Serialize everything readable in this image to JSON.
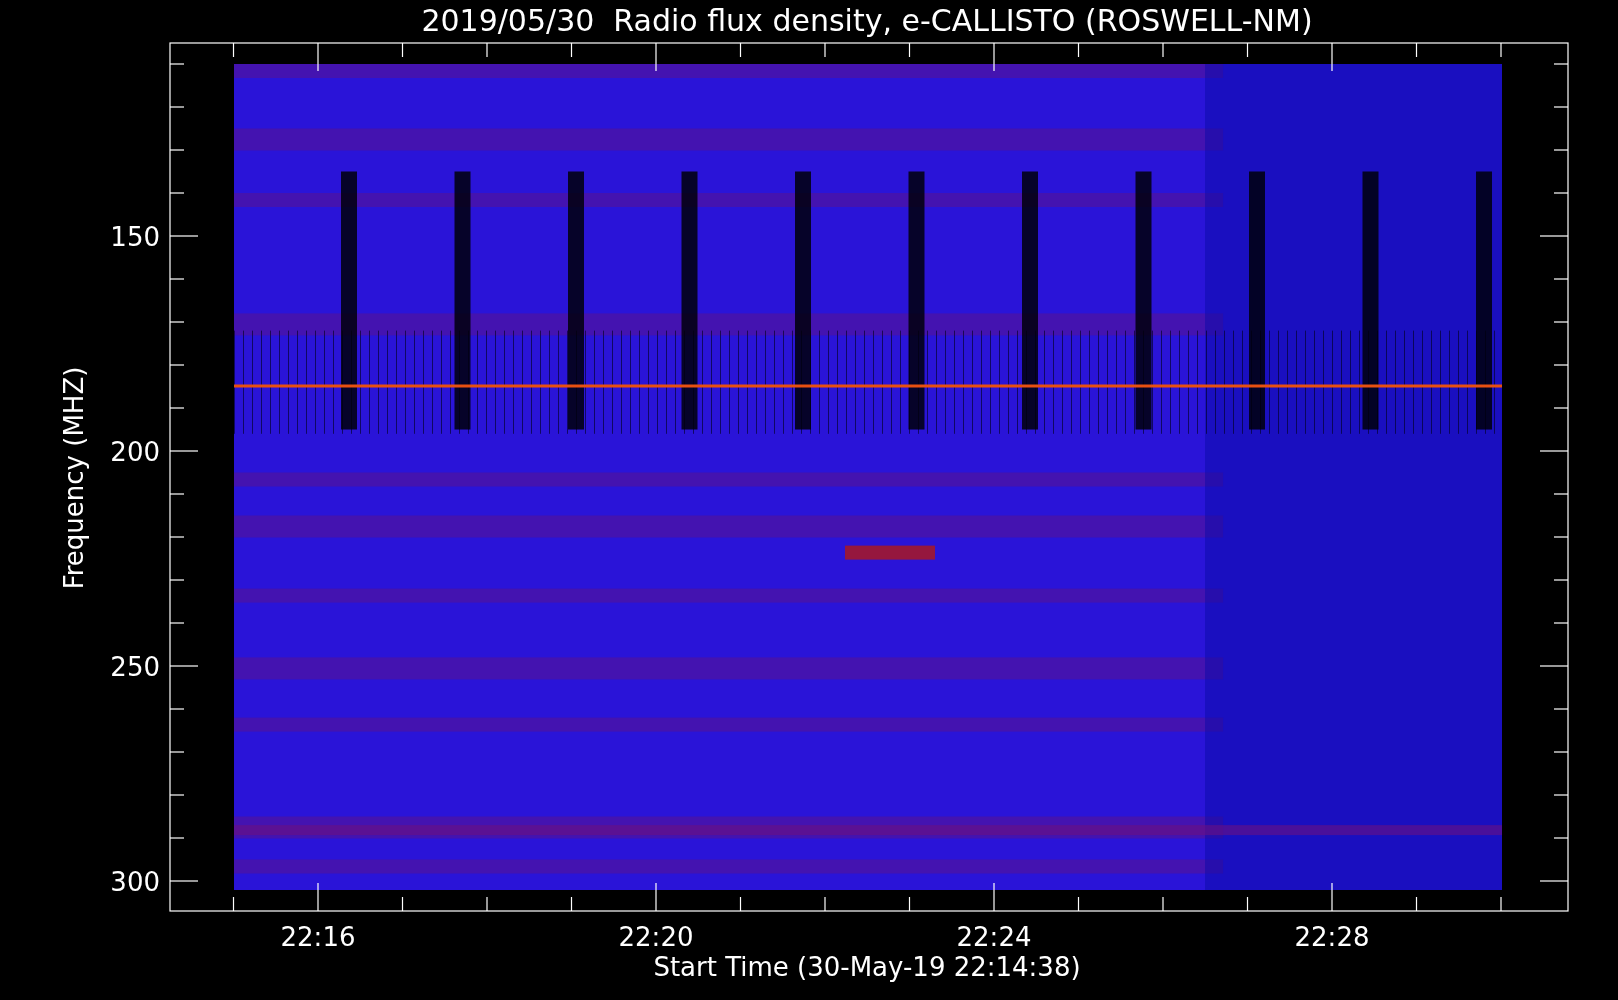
{
  "title": "2019/05/30  Radio flux density, e-CALLISTO (ROSWELL-NM)",
  "y_axis": {
    "label": "Frequency (MHZ)",
    "ticks": [
      "150",
      "200",
      "250",
      "300"
    ]
  },
  "x_axis": {
    "label": "Start Time (30-May-19 22:14:38)",
    "ticks": [
      "22:16",
      "22:20",
      "22:24",
      "22:28"
    ]
  }
}
